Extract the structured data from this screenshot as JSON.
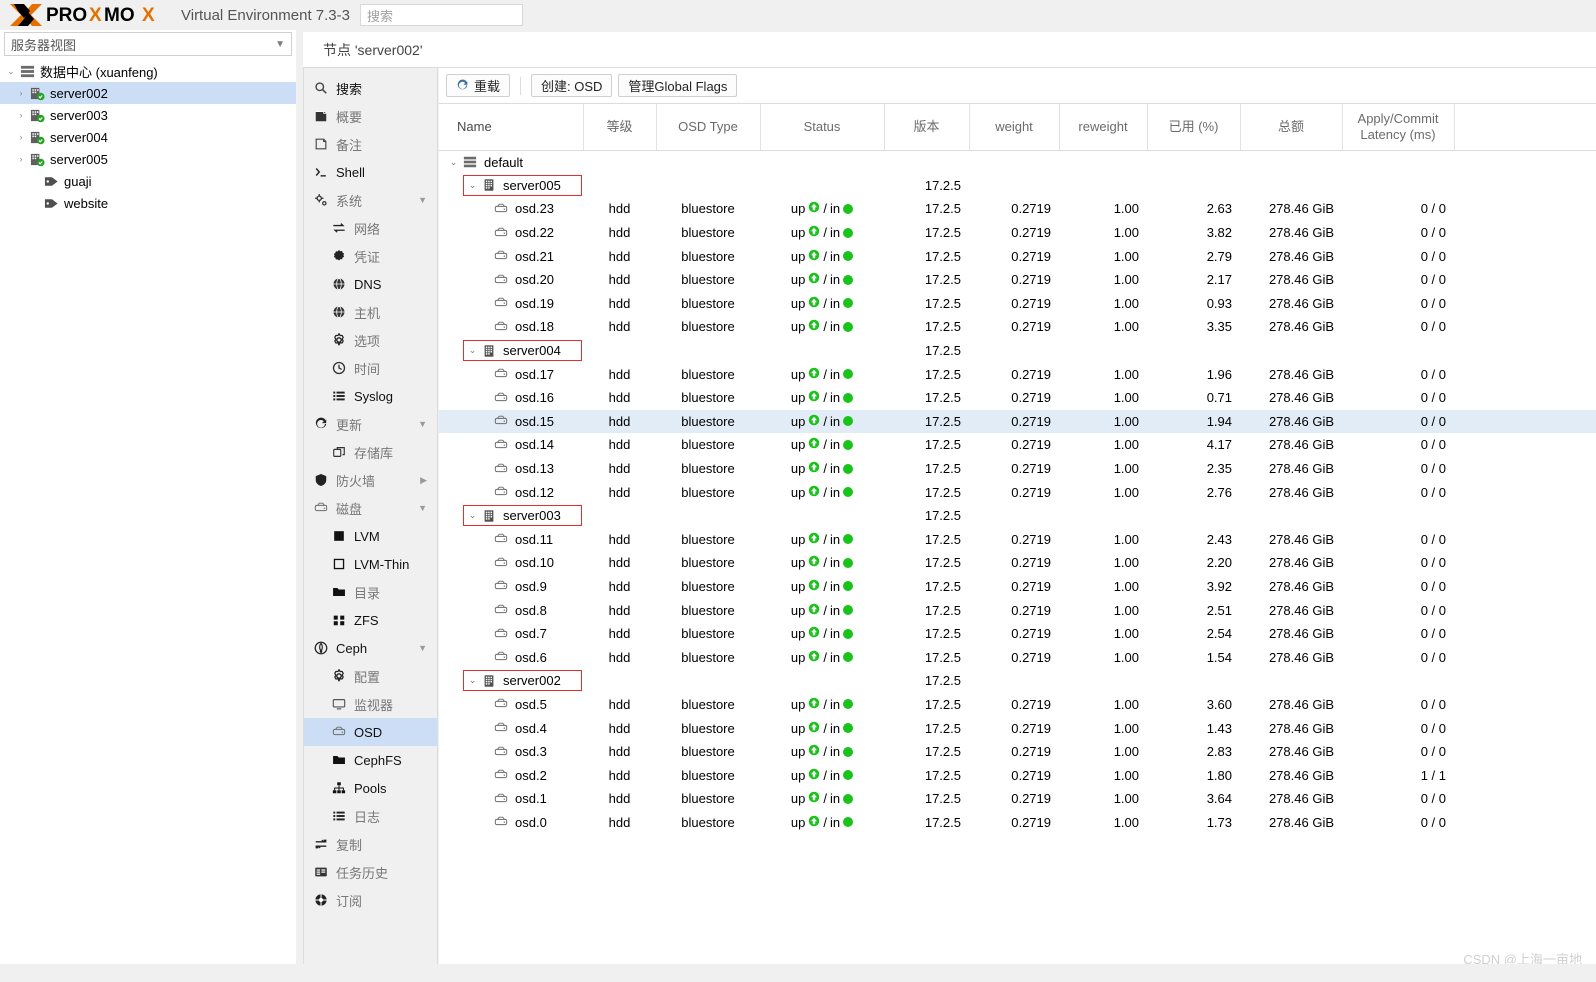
{
  "topbar": {
    "product": "Virtual Environment 7.3-3",
    "logo_text": "PROXMOX",
    "search_placeholder": "搜索"
  },
  "sidebar": {
    "view_selector": "服务器视图",
    "tree": [
      {
        "label": "数据中心 (xuanfeng)",
        "icon": "datacenter-icon",
        "level": 0,
        "arrow": "⌄",
        "selected": false
      },
      {
        "label": "server002",
        "icon": "node-ok-icon",
        "level": 1,
        "arrow": "›",
        "selected": true
      },
      {
        "label": "server003",
        "icon": "node-ok-icon",
        "level": 1,
        "arrow": "›",
        "selected": false
      },
      {
        "label": "server004",
        "icon": "node-ok-icon",
        "level": 1,
        "arrow": "›",
        "selected": false
      },
      {
        "label": "server005",
        "icon": "node-ok-icon",
        "level": 1,
        "arrow": "›",
        "selected": false
      },
      {
        "label": "guaji",
        "icon": "tag-icon",
        "level": 2,
        "arrow": "",
        "selected": false
      },
      {
        "label": "website",
        "icon": "tag-icon",
        "level": 2,
        "arrow": "",
        "selected": false
      }
    ]
  },
  "nav": {
    "items": [
      {
        "label": "搜索",
        "icon": "search-icon",
        "sub": false,
        "active": false,
        "dark": true,
        "arrow": ""
      },
      {
        "label": "概要",
        "icon": "summary-icon",
        "sub": false,
        "active": false,
        "dark": false,
        "arrow": ""
      },
      {
        "label": "备注",
        "icon": "notes-icon",
        "sub": false,
        "active": false,
        "dark": false,
        "arrow": ""
      },
      {
        "label": "Shell",
        "icon": "shell-icon",
        "sub": false,
        "active": false,
        "dark": true,
        "arrow": ""
      },
      {
        "label": "系统",
        "icon": "system-icon",
        "sub": false,
        "active": false,
        "dark": false,
        "arrow": "▼"
      },
      {
        "label": "网络",
        "icon": "network-icon",
        "sub": true,
        "active": false,
        "dark": false,
        "arrow": ""
      },
      {
        "label": "凭证",
        "icon": "certificate-icon",
        "sub": true,
        "active": false,
        "dark": false,
        "arrow": ""
      },
      {
        "label": "DNS",
        "icon": "dns-icon",
        "sub": true,
        "active": false,
        "dark": true,
        "arrow": ""
      },
      {
        "label": "主机",
        "icon": "hosts-icon",
        "sub": true,
        "active": false,
        "dark": false,
        "arrow": ""
      },
      {
        "label": "选项",
        "icon": "options-icon",
        "sub": true,
        "active": false,
        "dark": false,
        "arrow": ""
      },
      {
        "label": "时间",
        "icon": "time-icon",
        "sub": true,
        "active": false,
        "dark": false,
        "arrow": ""
      },
      {
        "label": "Syslog",
        "icon": "syslog-icon",
        "sub": true,
        "active": false,
        "dark": true,
        "arrow": ""
      },
      {
        "label": "更新",
        "icon": "update-icon",
        "sub": false,
        "active": false,
        "dark": false,
        "arrow": "▼"
      },
      {
        "label": "存储库",
        "icon": "repository-icon",
        "sub": true,
        "active": false,
        "dark": false,
        "arrow": ""
      },
      {
        "label": "防火墙",
        "icon": "firewall-icon",
        "sub": false,
        "active": false,
        "dark": false,
        "arrow": "▶"
      },
      {
        "label": "磁盘",
        "icon": "disk-icon",
        "sub": false,
        "active": false,
        "dark": false,
        "arrow": "▼"
      },
      {
        "label": "LVM",
        "icon": "lvm-icon",
        "sub": true,
        "active": false,
        "dark": true,
        "arrow": ""
      },
      {
        "label": "LVM-Thin",
        "icon": "lvmthin-icon",
        "sub": true,
        "active": false,
        "dark": true,
        "arrow": ""
      },
      {
        "label": "目录",
        "icon": "directory-icon",
        "sub": true,
        "active": false,
        "dark": false,
        "arrow": ""
      },
      {
        "label": "ZFS",
        "icon": "zfs-icon",
        "sub": true,
        "active": false,
        "dark": true,
        "arrow": ""
      },
      {
        "label": "Ceph",
        "icon": "ceph-icon",
        "sub": false,
        "active": false,
        "dark": true,
        "arrow": "▼"
      },
      {
        "label": "配置",
        "icon": "config-icon",
        "sub": true,
        "active": false,
        "dark": false,
        "arrow": ""
      },
      {
        "label": "监视器",
        "icon": "monitor-icon",
        "sub": true,
        "active": false,
        "dark": false,
        "arrow": ""
      },
      {
        "label": "OSD",
        "icon": "osd-icon",
        "sub": true,
        "active": true,
        "dark": true,
        "arrow": ""
      },
      {
        "label": "CephFS",
        "icon": "cephfs-icon",
        "sub": true,
        "active": false,
        "dark": true,
        "arrow": ""
      },
      {
        "label": "Pools",
        "icon": "pools-icon",
        "sub": true,
        "active": false,
        "dark": true,
        "arrow": ""
      },
      {
        "label": "日志",
        "icon": "log-icon",
        "sub": true,
        "active": false,
        "dark": false,
        "arrow": ""
      },
      {
        "label": "复制",
        "icon": "replication-icon",
        "sub": false,
        "active": false,
        "dark": false,
        "arrow": ""
      },
      {
        "label": "任务历史",
        "icon": "task-history-icon",
        "sub": false,
        "active": false,
        "dark": false,
        "arrow": ""
      },
      {
        "label": "订阅",
        "icon": "subscription-icon",
        "sub": false,
        "active": false,
        "dark": false,
        "arrow": ""
      }
    ]
  },
  "node_header": "节点 'server002'",
  "toolbar": {
    "reload": "重载",
    "create_osd": "创建: OSD",
    "manage_global_flags": "管理Global Flags"
  },
  "table": {
    "columns": [
      "Name",
      "等级",
      "OSD Type",
      "Status",
      "版本",
      "weight",
      "reweight",
      "已用 (%)",
      "总额",
      "Apply/Commit Latency (ms)"
    ],
    "rows": [
      {
        "kind": "root",
        "name": "default",
        "arrow": "⌄",
        "icon": "crush-root-icon",
        "class": "",
        "type": "",
        "status_up": "",
        "status_in": "",
        "version": "",
        "weight": "",
        "reweight": "",
        "used": "",
        "total": "",
        "latency": "",
        "selected": false
      },
      {
        "kind": "host",
        "name": "server005",
        "arrow": "⌄",
        "icon": "host-icon",
        "class": "",
        "type": "",
        "status_up": "",
        "status_in": "",
        "version": "17.2.5",
        "weight": "",
        "reweight": "",
        "used": "",
        "total": "",
        "latency": "",
        "selected": false
      },
      {
        "kind": "osd",
        "name": "osd.23",
        "arrow": "",
        "icon": "osd-disk-icon",
        "class": "hdd",
        "type": "bluestore",
        "status_up": "up",
        "status_in": "in",
        "version": "17.2.5",
        "weight": "0.2719",
        "reweight": "1.00",
        "used": "2.63",
        "total": "278.46 GiB",
        "latency": "0 / 0",
        "selected": false
      },
      {
        "kind": "osd",
        "name": "osd.22",
        "arrow": "",
        "icon": "osd-disk-icon",
        "class": "hdd",
        "type": "bluestore",
        "status_up": "up",
        "status_in": "in",
        "version": "17.2.5",
        "weight": "0.2719",
        "reweight": "1.00",
        "used": "3.82",
        "total": "278.46 GiB",
        "latency": "0 / 0",
        "selected": false
      },
      {
        "kind": "osd",
        "name": "osd.21",
        "arrow": "",
        "icon": "osd-disk-icon",
        "class": "hdd",
        "type": "bluestore",
        "status_up": "up",
        "status_in": "in",
        "version": "17.2.5",
        "weight": "0.2719",
        "reweight": "1.00",
        "used": "2.79",
        "total": "278.46 GiB",
        "latency": "0 / 0",
        "selected": false
      },
      {
        "kind": "osd",
        "name": "osd.20",
        "arrow": "",
        "icon": "osd-disk-icon",
        "class": "hdd",
        "type": "bluestore",
        "status_up": "up",
        "status_in": "in",
        "version": "17.2.5",
        "weight": "0.2719",
        "reweight": "1.00",
        "used": "2.17",
        "total": "278.46 GiB",
        "latency": "0 / 0",
        "selected": false
      },
      {
        "kind": "osd",
        "name": "osd.19",
        "arrow": "",
        "icon": "osd-disk-icon",
        "class": "hdd",
        "type": "bluestore",
        "status_up": "up",
        "status_in": "in",
        "version": "17.2.5",
        "weight": "0.2719",
        "reweight": "1.00",
        "used": "0.93",
        "total": "278.46 GiB",
        "latency": "0 / 0",
        "selected": false
      },
      {
        "kind": "osd",
        "name": "osd.18",
        "arrow": "",
        "icon": "osd-disk-icon",
        "class": "hdd",
        "type": "bluestore",
        "status_up": "up",
        "status_in": "in",
        "version": "17.2.5",
        "weight": "0.2719",
        "reweight": "1.00",
        "used": "3.35",
        "total": "278.46 GiB",
        "latency": "0 / 0",
        "selected": false
      },
      {
        "kind": "host",
        "name": "server004",
        "arrow": "⌄",
        "icon": "host-icon",
        "class": "",
        "type": "",
        "status_up": "",
        "status_in": "",
        "version": "17.2.5",
        "weight": "",
        "reweight": "",
        "used": "",
        "total": "",
        "latency": "",
        "selected": false
      },
      {
        "kind": "osd",
        "name": "osd.17",
        "arrow": "",
        "icon": "osd-disk-icon",
        "class": "hdd",
        "type": "bluestore",
        "status_up": "up",
        "status_in": "in",
        "version": "17.2.5",
        "weight": "0.2719",
        "reweight": "1.00",
        "used": "1.96",
        "total": "278.46 GiB",
        "latency": "0 / 0",
        "selected": false
      },
      {
        "kind": "osd",
        "name": "osd.16",
        "arrow": "",
        "icon": "osd-disk-icon",
        "class": "hdd",
        "type": "bluestore",
        "status_up": "up",
        "status_in": "in",
        "version": "17.2.5",
        "weight": "0.2719",
        "reweight": "1.00",
        "used": "0.71",
        "total": "278.46 GiB",
        "latency": "0 / 0",
        "selected": false
      },
      {
        "kind": "osd",
        "name": "osd.15",
        "arrow": "",
        "icon": "osd-disk-icon",
        "class": "hdd",
        "type": "bluestore",
        "status_up": "up",
        "status_in": "in",
        "version": "17.2.5",
        "weight": "0.2719",
        "reweight": "1.00",
        "used": "1.94",
        "total": "278.46 GiB",
        "latency": "0 / 0",
        "selected": true
      },
      {
        "kind": "osd",
        "name": "osd.14",
        "arrow": "",
        "icon": "osd-disk-icon",
        "class": "hdd",
        "type": "bluestore",
        "status_up": "up",
        "status_in": "in",
        "version": "17.2.5",
        "weight": "0.2719",
        "reweight": "1.00",
        "used": "4.17",
        "total": "278.46 GiB",
        "latency": "0 / 0",
        "selected": false
      },
      {
        "kind": "osd",
        "name": "osd.13",
        "arrow": "",
        "icon": "osd-disk-icon",
        "class": "hdd",
        "type": "bluestore",
        "status_up": "up",
        "status_in": "in",
        "version": "17.2.5",
        "weight": "0.2719",
        "reweight": "1.00",
        "used": "2.35",
        "total": "278.46 GiB",
        "latency": "0 / 0",
        "selected": false
      },
      {
        "kind": "osd",
        "name": "osd.12",
        "arrow": "",
        "icon": "osd-disk-icon",
        "class": "hdd",
        "type": "bluestore",
        "status_up": "up",
        "status_in": "in",
        "version": "17.2.5",
        "weight": "0.2719",
        "reweight": "1.00",
        "used": "2.76",
        "total": "278.46 GiB",
        "latency": "0 / 0",
        "selected": false
      },
      {
        "kind": "host",
        "name": "server003",
        "arrow": "⌄",
        "icon": "host-icon",
        "class": "",
        "type": "",
        "status_up": "",
        "status_in": "",
        "version": "17.2.5",
        "weight": "",
        "reweight": "",
        "used": "",
        "total": "",
        "latency": "",
        "selected": false
      },
      {
        "kind": "osd",
        "name": "osd.11",
        "arrow": "",
        "icon": "osd-disk-icon",
        "class": "hdd",
        "type": "bluestore",
        "status_up": "up",
        "status_in": "in",
        "version": "17.2.5",
        "weight": "0.2719",
        "reweight": "1.00",
        "used": "2.43",
        "total": "278.46 GiB",
        "latency": "0 / 0",
        "selected": false
      },
      {
        "kind": "osd",
        "name": "osd.10",
        "arrow": "",
        "icon": "osd-disk-icon",
        "class": "hdd",
        "type": "bluestore",
        "status_up": "up",
        "status_in": "in",
        "version": "17.2.5",
        "weight": "0.2719",
        "reweight": "1.00",
        "used": "2.20",
        "total": "278.46 GiB",
        "latency": "0 / 0",
        "selected": false
      },
      {
        "kind": "osd",
        "name": "osd.9",
        "arrow": "",
        "icon": "osd-disk-icon",
        "class": "hdd",
        "type": "bluestore",
        "status_up": "up",
        "status_in": "in",
        "version": "17.2.5",
        "weight": "0.2719",
        "reweight": "1.00",
        "used": "3.92",
        "total": "278.46 GiB",
        "latency": "0 / 0",
        "selected": false
      },
      {
        "kind": "osd",
        "name": "osd.8",
        "arrow": "",
        "icon": "osd-disk-icon",
        "class": "hdd",
        "type": "bluestore",
        "status_up": "up",
        "status_in": "in",
        "version": "17.2.5",
        "weight": "0.2719",
        "reweight": "1.00",
        "used": "2.51",
        "total": "278.46 GiB",
        "latency": "0 / 0",
        "selected": false
      },
      {
        "kind": "osd",
        "name": "osd.7",
        "arrow": "",
        "icon": "osd-disk-icon",
        "class": "hdd",
        "type": "bluestore",
        "status_up": "up",
        "status_in": "in",
        "version": "17.2.5",
        "weight": "0.2719",
        "reweight": "1.00",
        "used": "2.54",
        "total": "278.46 GiB",
        "latency": "0 / 0",
        "selected": false
      },
      {
        "kind": "osd",
        "name": "osd.6",
        "arrow": "",
        "icon": "osd-disk-icon",
        "class": "hdd",
        "type": "bluestore",
        "status_up": "up",
        "status_in": "in",
        "version": "17.2.5",
        "weight": "0.2719",
        "reweight": "1.00",
        "used": "1.54",
        "total": "278.46 GiB",
        "latency": "0 / 0",
        "selected": false
      },
      {
        "kind": "host",
        "name": "server002",
        "arrow": "⌄",
        "icon": "host-icon",
        "class": "",
        "type": "",
        "status_up": "",
        "status_in": "",
        "version": "17.2.5",
        "weight": "",
        "reweight": "",
        "used": "",
        "total": "",
        "latency": "",
        "selected": false
      },
      {
        "kind": "osd",
        "name": "osd.5",
        "arrow": "",
        "icon": "osd-disk-icon",
        "class": "hdd",
        "type": "bluestore",
        "status_up": "up",
        "status_in": "in",
        "version": "17.2.5",
        "weight": "0.2719",
        "reweight": "1.00",
        "used": "3.60",
        "total": "278.46 GiB",
        "latency": "0 / 0",
        "selected": false
      },
      {
        "kind": "osd",
        "name": "osd.4",
        "arrow": "",
        "icon": "osd-disk-icon",
        "class": "hdd",
        "type": "bluestore",
        "status_up": "up",
        "status_in": "in",
        "version": "17.2.5",
        "weight": "0.2719",
        "reweight": "1.00",
        "used": "1.43",
        "total": "278.46 GiB",
        "latency": "0 / 0",
        "selected": false
      },
      {
        "kind": "osd",
        "name": "osd.3",
        "arrow": "",
        "icon": "osd-disk-icon",
        "class": "hdd",
        "type": "bluestore",
        "status_up": "up",
        "status_in": "in",
        "version": "17.2.5",
        "weight": "0.2719",
        "reweight": "1.00",
        "used": "2.83",
        "total": "278.46 GiB",
        "latency": "0 / 0",
        "selected": false
      },
      {
        "kind": "osd",
        "name": "osd.2",
        "arrow": "",
        "icon": "osd-disk-icon",
        "class": "hdd",
        "type": "bluestore",
        "status_up": "up",
        "status_in": "in",
        "version": "17.2.5",
        "weight": "0.2719",
        "reweight": "1.00",
        "used": "1.80",
        "total": "278.46 GiB",
        "latency": "1 / 1",
        "selected": false
      },
      {
        "kind": "osd",
        "name": "osd.1",
        "arrow": "",
        "icon": "osd-disk-icon",
        "class": "hdd",
        "type": "bluestore",
        "status_up": "up",
        "status_in": "in",
        "version": "17.2.5",
        "weight": "0.2719",
        "reweight": "1.00",
        "used": "3.64",
        "total": "278.46 GiB",
        "latency": "0 / 0",
        "selected": false
      },
      {
        "kind": "osd",
        "name": "osd.0",
        "arrow": "",
        "icon": "osd-disk-icon",
        "class": "hdd",
        "type": "bluestore",
        "status_up": "up",
        "status_in": "in",
        "version": "17.2.5",
        "weight": "0.2719",
        "reweight": "1.00",
        "used": "1.73",
        "total": "278.46 GiB",
        "latency": "0 / 0",
        "selected": false
      }
    ]
  },
  "watermark": "CSDN @上海一亩地",
  "colors": {
    "accent_orange": "#E57000",
    "selection_blue": "#ccdef5",
    "row_selection": "#e2ecf7",
    "status_green": "#19c319",
    "highlight_red": "#e03030"
  }
}
